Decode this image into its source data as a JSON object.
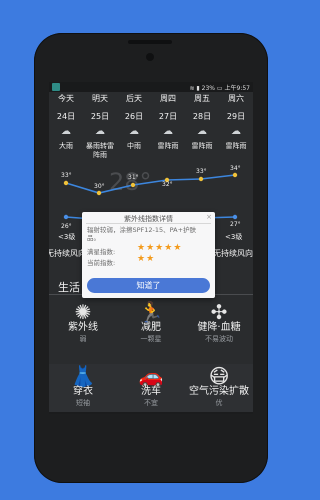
{
  "status_bar": {
    "battery": "23%",
    "time": "上午9:57"
  },
  "forecast": {
    "weekdays": [
      "今天",
      "明天",
      "后天",
      "周四",
      "周五",
      "周六"
    ],
    "dates": [
      "24日",
      "25日",
      "26日",
      "27日",
      "28日",
      "29日"
    ],
    "icons": [
      "rain-icon",
      "rain-icon",
      "rain-icon",
      "thunderstorm-icon",
      "thunderstorm-icon",
      "thunderstorm-icon"
    ],
    "conditions": [
      "大雨",
      "暴雨转雷阵雨",
      "中雨",
      "雷阵雨",
      "雷阵雨",
      "雷阵雨"
    ],
    "background_temp": "28°",
    "highs": [
      "33°",
      "30°",
      "31°",
      "32°",
      "33°",
      "34°"
    ],
    "lows": [
      "26°",
      "",
      "",
      "",
      "",
      "27°"
    ],
    "wind_levels": [
      "<3级",
      "<3级"
    ],
    "wind_desc": [
      "无持续风向",
      "无持续风向"
    ]
  },
  "life_index": {
    "label": "生活",
    "items": [
      {
        "name": "紫外线",
        "value": "弱",
        "icon": "uv-sun-icon"
      },
      {
        "name": "减肥",
        "value": "一颗星",
        "icon": "runner-icon"
      },
      {
        "name": "健降·血糖",
        "value": "不易波动",
        "icon": "blood-drop-icon"
      },
      {
        "name": "穿衣",
        "value": "短袖",
        "icon": "dress-icon"
      },
      {
        "name": "洗车",
        "value": "不宜",
        "icon": "car-icon"
      },
      {
        "name": "空气污染扩散",
        "value": "优",
        "icon": "mask-icon"
      }
    ]
  },
  "dialog": {
    "title": "紫外线指数详情",
    "description": "辐射较弱，涂擦SPF12-15、PA+护肤品。",
    "label_full": "满星指数:",
    "full_stars": 5,
    "label_current": "当前指数:",
    "current_stars": 2,
    "ok_label": "知道了"
  },
  "colors": {
    "background": "#3d7be0",
    "accent": "#4a78d6",
    "star": "#f39a1b"
  }
}
